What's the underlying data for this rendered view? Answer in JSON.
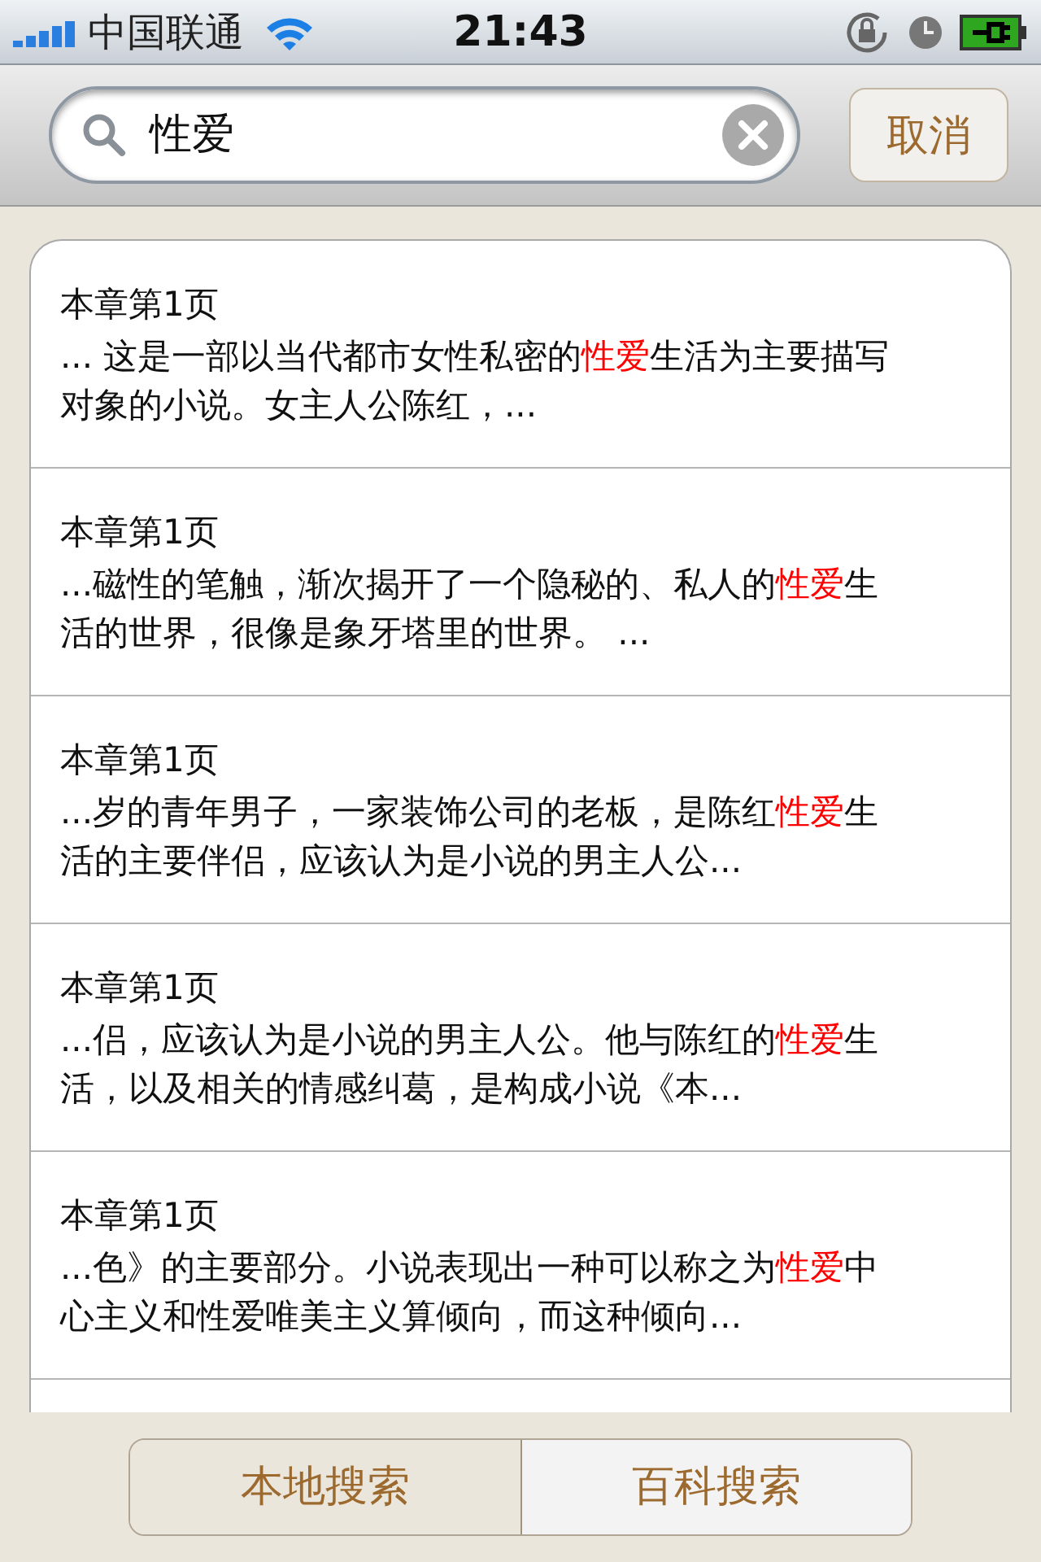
{
  "status_bar": {
    "carrier": "中国联通",
    "time": "21:43"
  },
  "search": {
    "value": "性爱",
    "cancel": "取消"
  },
  "results": [
    {
      "title": "本章第1页",
      "snippet": [
        {
          "text": "... 这是一部以当代都市女性私密的",
          "highlight": false
        },
        {
          "text": "性爱",
          "highlight": true
        },
        {
          "text": "生活为主要描写对象的小说。女主人公陈红，...",
          "highlight": false
        }
      ]
    },
    {
      "title": "本章第1页",
      "snippet": [
        {
          "text": "...磁性的笔触，渐次揭开了一个隐秘的、私人的",
          "highlight": false
        },
        {
          "text": "性爱",
          "highlight": true
        },
        {
          "text": "生活的世界，很像是象牙塔里的世界。 ...",
          "highlight": false
        }
      ]
    },
    {
      "title": "本章第1页",
      "snippet": [
        {
          "text": "...岁的青年男子，一家装饰公司的老板，是陈红",
          "highlight": false
        },
        {
          "text": "性爱",
          "highlight": true
        },
        {
          "text": "生活的主要伴侣，应该认为是小说的男主人公...",
          "highlight": false
        }
      ]
    },
    {
      "title": "本章第1页",
      "snippet": [
        {
          "text": "...侣，应该认为是小说的男主人公。他与陈红的",
          "highlight": false
        },
        {
          "text": "性爱",
          "highlight": true
        },
        {
          "text": "生活，以及相关的情感纠葛，是构成小说《本...",
          "highlight": false
        }
      ]
    },
    {
      "title": "本章第1页",
      "snippet": [
        {
          "text": "...色》的主要部分。小说表现出一种可以称之为",
          "highlight": false
        },
        {
          "text": "性爱",
          "highlight": true
        },
        {
          "text": "中心主义和性爱唯美主义算倾向，而这种倾向...",
          "highlight": false
        }
      ]
    }
  ],
  "tabs": [
    {
      "label": "本地搜索",
      "selected": true
    },
    {
      "label": "百科搜索",
      "selected": false
    }
  ]
}
